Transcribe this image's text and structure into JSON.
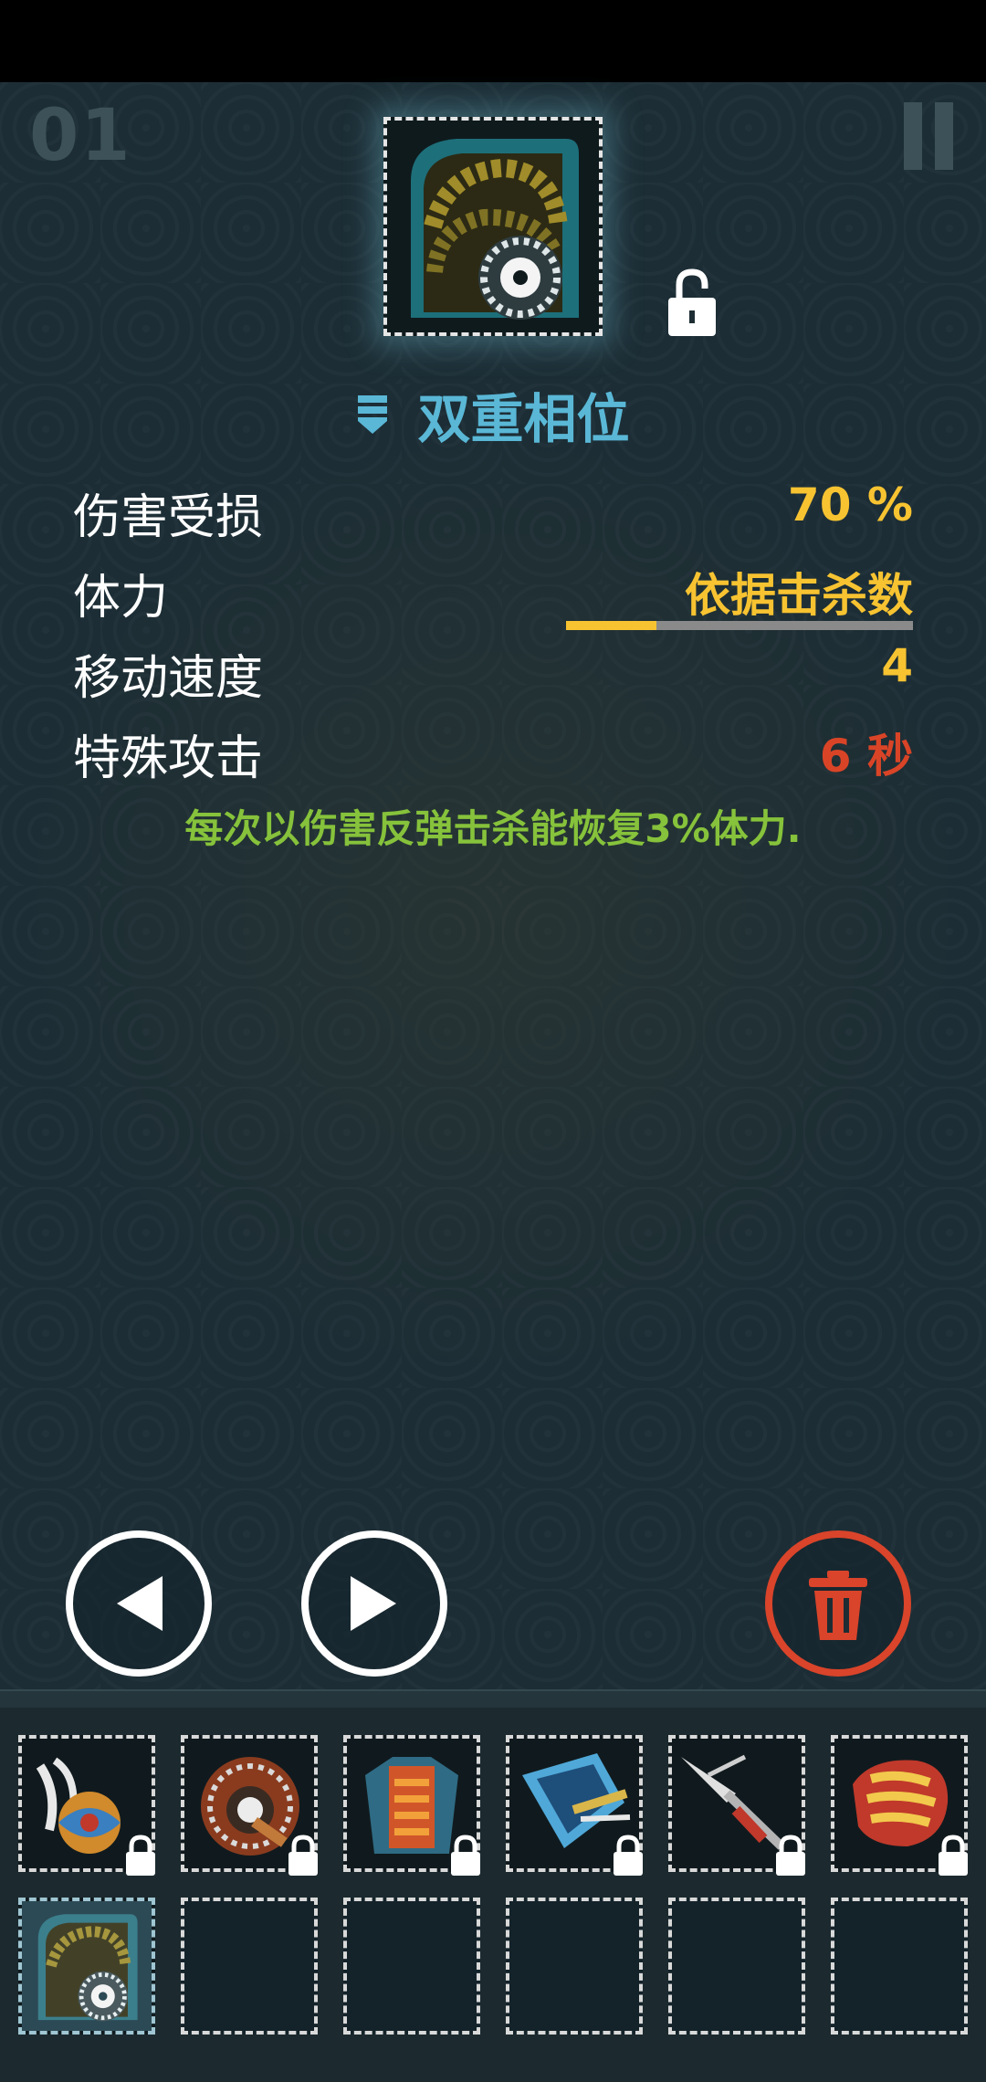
{
  "hud": {
    "level": "01",
    "pause_icon": "pause-icon"
  },
  "item": {
    "name": "双重相位",
    "icon": "shield-gear-icon",
    "lock_state": "unlocked",
    "stats": [
      {
        "label": "伤害受损",
        "value": "70 %",
        "color": "#f7c331"
      },
      {
        "label": "体力",
        "value": "依据击杀数",
        "color": "#f7c331"
      },
      {
        "label": "移动速度",
        "value": "4",
        "color": "#f7c331"
      },
      {
        "label": "特殊攻击",
        "value": "6 秒",
        "color": "#d94427"
      }
    ],
    "stamina_fill_fraction": 0.26,
    "description": "每次以伤害反弹击杀能恢复3%体力."
  },
  "controls": {
    "prev_icon": "left-arrow-icon",
    "next_icon": "right-arrow-icon",
    "delete_icon": "trash-icon"
  },
  "inventory": {
    "locked_items": [
      "feather-shield-icon",
      "gear-armor-icon",
      "chest-armor-icon",
      "blade-icon",
      "spear-icon",
      "fist-icon"
    ],
    "equipped": [
      "shield-gear-icon",
      "",
      "",
      "",
      "",
      ""
    ]
  },
  "colors": {
    "accent": "#5ab7d6",
    "value": "#f7c331",
    "danger": "#d94427",
    "description": "#86c23b"
  }
}
